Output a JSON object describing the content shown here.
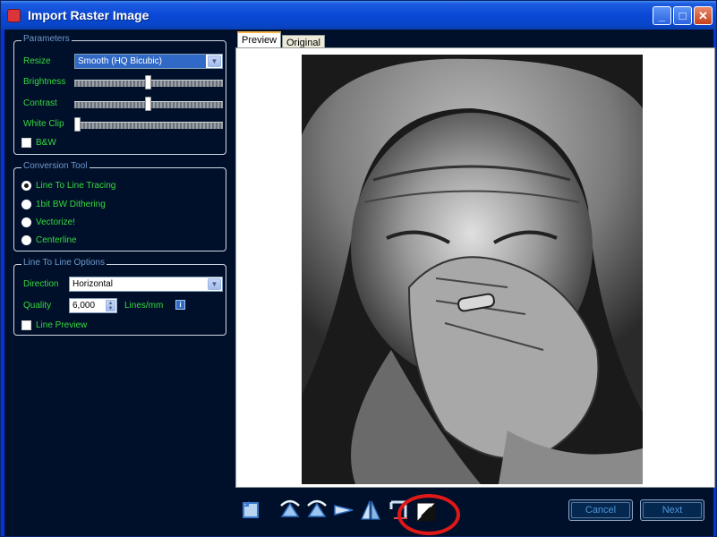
{
  "window": {
    "title": "Import Raster Image",
    "min_glyph": "_",
    "max_glyph": "□",
    "close_glyph": "✕"
  },
  "parameters": {
    "legend": "Parameters",
    "resize_label": "Resize",
    "resize_value": "Smooth (HQ Bicubic)",
    "brightness_label": "Brightness",
    "brightness_level": 0.5,
    "contrast_label": "Contrast",
    "contrast_level": 0.5,
    "white_clip_label": "White Clip",
    "white_clip_level": 0.0,
    "bw_label": "B&W",
    "bw_checked": false
  },
  "conversion": {
    "legend": "Conversion Tool",
    "options": [
      {
        "label": "Line To Line Tracing",
        "selected": true
      },
      {
        "label": "1bit BW Dithering",
        "selected": false
      },
      {
        "label": "Vectorize!",
        "selected": false
      },
      {
        "label": "Centerline",
        "selected": false
      }
    ]
  },
  "line_options": {
    "legend": "Line To Line Options",
    "direction_label": "Direction",
    "direction_value": "Horizontal",
    "quality_label": "Quality",
    "quality_value": "6,000",
    "quality_unit": "Lines/mm",
    "info_glyph": "i",
    "line_preview_label": "Line Preview",
    "line_preview_checked": false
  },
  "preview": {
    "tabs": [
      {
        "label": "Preview",
        "active": true
      },
      {
        "label": "Original",
        "active": false
      }
    ]
  },
  "toolbar": {
    "icons": [
      "rotate-icon",
      "rotate-left-icon",
      "rotate-right-icon",
      "flip-horizontal-icon",
      "mirror-icon",
      "crop-icon",
      "invert-icon"
    ],
    "cancel_label": "Cancel",
    "next_label": "Next"
  },
  "colors": {
    "panel_bg": "#01102a",
    "label_blue": "#6f98cc",
    "label_green": "#36d93e",
    "annotation_red": "#e01818"
  }
}
